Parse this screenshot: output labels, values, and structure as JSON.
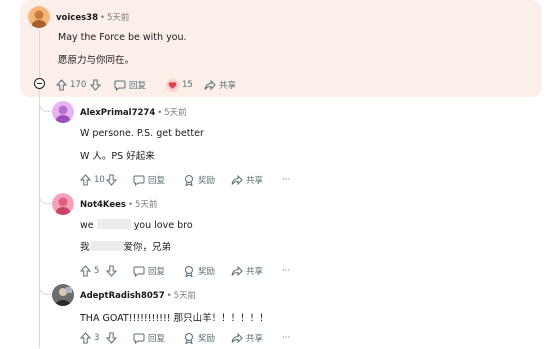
{
  "root": {
    "author": "voices38",
    "time": "5天前",
    "lines": [
      "May the Force be with you.",
      "愿原力与你同在。"
    ],
    "actions": {
      "votes": "170",
      "reply": "回复",
      "award_count": "15",
      "share": "共享"
    }
  },
  "replies": [
    {
      "author": "AlexPrimal7274",
      "time": "5天前",
      "line1": "W persone. P.S. get better",
      "line2": "W 人。PS 好起来",
      "votes": "10",
      "reply": "回复",
      "award": "奖励",
      "share": "共享",
      "more": "···"
    },
    {
      "author": "Not4Kees",
      "time": "5天前",
      "line1_a": "we",
      "line1_b": "you love bro",
      "line2_a": "我",
      "line2_b": "爱你，兄弟",
      "votes": "5",
      "reply": "回复",
      "award": "奖励",
      "share": "共享",
      "more": "···"
    },
    {
      "author": "AdeptRadish8057",
      "time": "5天前",
      "line1": "THA GOAT!!!!!!!!!!!   那只山羊！！！！！！",
      "votes": "3",
      "reply": "回复",
      "award": "奖励",
      "share": "共享",
      "more": "···"
    }
  ],
  "separator": "•",
  "colors": {
    "highlight_bg": "#fcefe9",
    "meta": "#7c7c7c",
    "action": "#576f76",
    "thread": "#d7dadc"
  }
}
